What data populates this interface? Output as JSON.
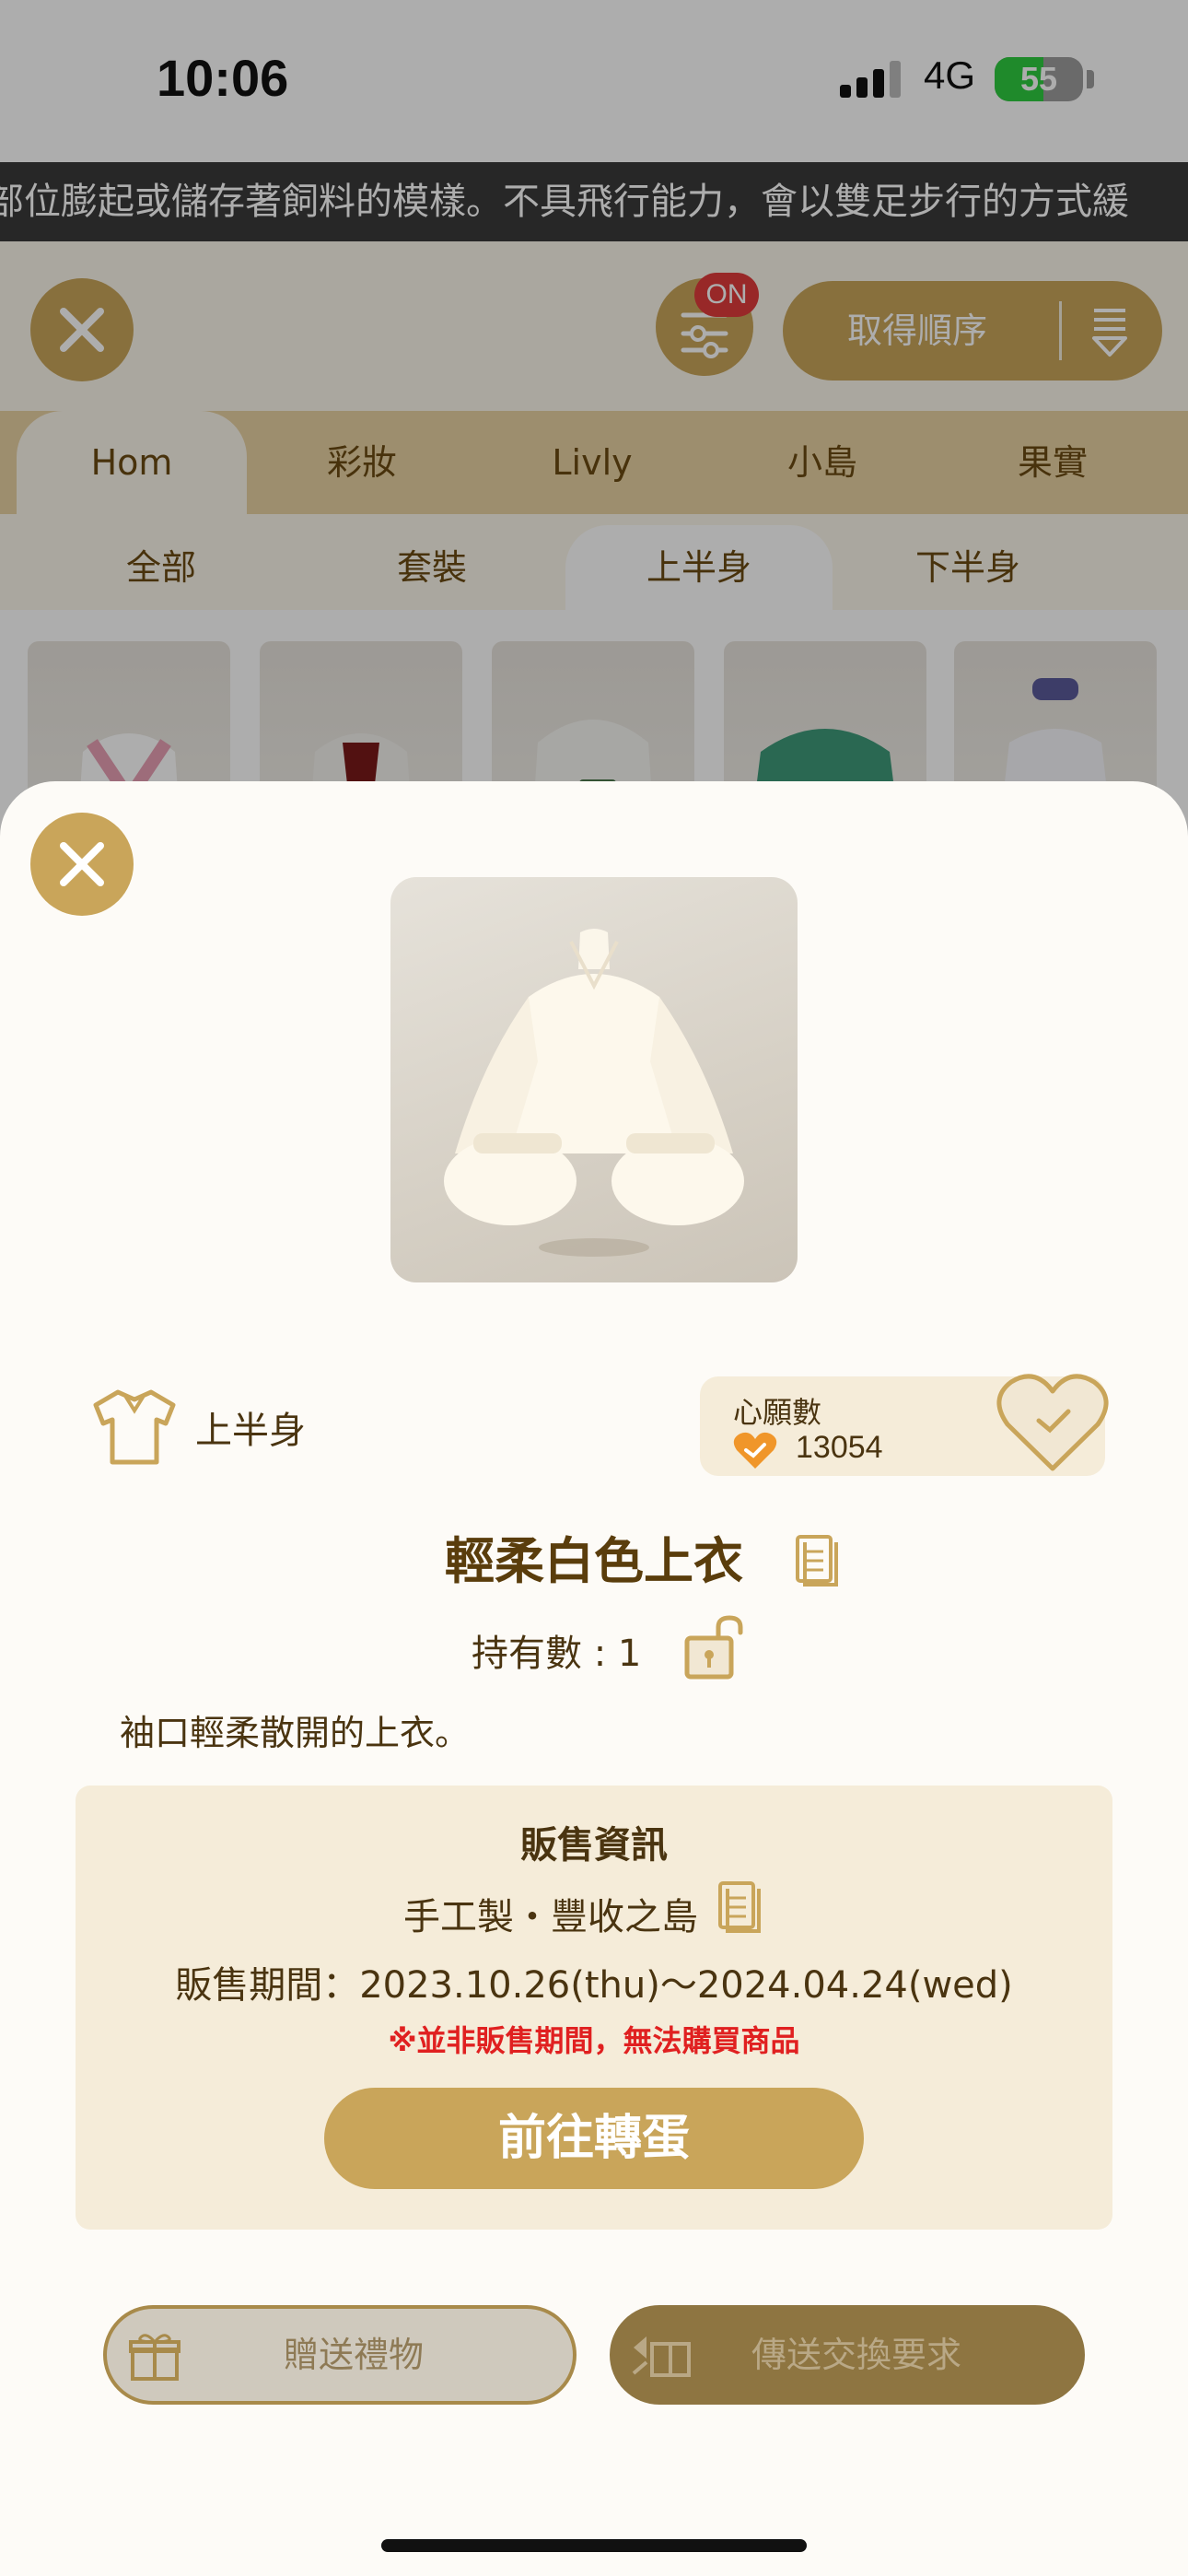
{
  "status_bar": {
    "time": "10:06",
    "network": "4G",
    "battery_percent": "55",
    "battery_level": 0.55
  },
  "marquee": {
    "text": "部位膨起或儲存著飼料的模樣。不具飛行能力，會以雙足步行的方式緩"
  },
  "toolbar": {
    "filter_badge": "ON",
    "sort_label": "取得順序"
  },
  "category_tabs": [
    {
      "label": "Hom",
      "active": true
    },
    {
      "label": "彩妝",
      "active": false
    },
    {
      "label": "Livly",
      "active": false
    },
    {
      "label": "小島",
      "active": false
    },
    {
      "label": "果實",
      "active": false
    }
  ],
  "sub_tabs": [
    {
      "label": "全部",
      "active": false
    },
    {
      "label": "套裝",
      "active": false
    },
    {
      "label": "上半身",
      "active": true
    },
    {
      "label": "下半身",
      "active": false
    }
  ],
  "modal": {
    "category_label": "上半身",
    "wish": {
      "label": "心願數",
      "count": "13054"
    },
    "item_name": "輕柔白色上衣",
    "owned": "持有數 : 1",
    "description": "袖口輕柔散開的上衣。",
    "sale": {
      "title": "販售資訊",
      "source": "手工製・豐收之島",
      "period": "販售期間：2023.10.26(thu)～2024.04.24(wed)",
      "warning": "※並非販售期間，無法購買商品",
      "button": "前往轉蛋"
    },
    "gift_button": "贈送禮物",
    "trade_button": "傳送交換要求"
  },
  "icons": {
    "close": "close-icon",
    "filter": "sliders-icon",
    "sort": "sort-icon",
    "category": "shirt-icon",
    "wish": "heart-check-icon",
    "copy": "copy-icon",
    "lock": "unlock-icon",
    "gift": "gift-icon",
    "trade": "exchange-icon"
  },
  "colors": {
    "accent": "#c9a55a",
    "panel": "#f5ecd9",
    "text": "#4a3410",
    "warning": "#e02020",
    "heart": "#f0962a"
  }
}
